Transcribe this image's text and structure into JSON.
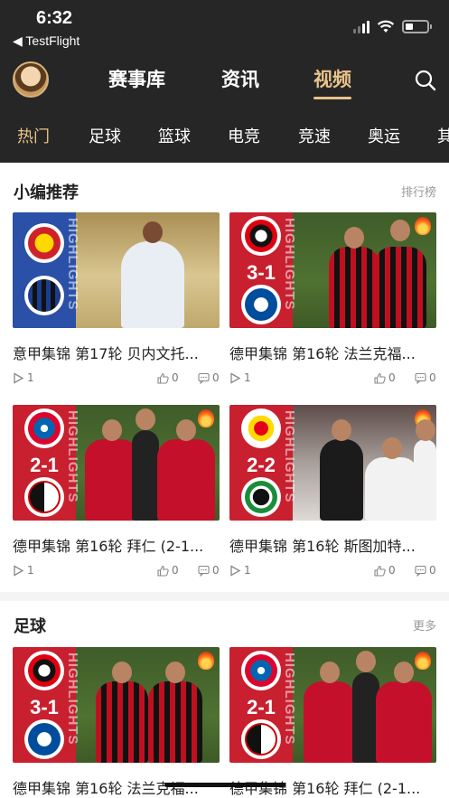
{
  "status": {
    "time": "6:32",
    "back_app": "◀ TestFlight"
  },
  "nav": {
    "tabs": [
      "赛事库",
      "资讯",
      "视频"
    ],
    "active_tab": "视频"
  },
  "categories": [
    "热门",
    "足球",
    "篮球",
    "电竞",
    "竞速",
    "奥运",
    "其"
  ],
  "active_category": "热门",
  "sections": [
    {
      "title": "小编推荐",
      "more": "排行榜",
      "cards": [
        {
          "title": "意甲集锦 第17轮 贝内文托...",
          "plays": "1",
          "likes": "0",
          "comments": "0",
          "score": "",
          "overlay": "HIGHLIGHTS"
        },
        {
          "title": "德甲集锦 第16轮 法兰克福...",
          "plays": "1",
          "likes": "0",
          "comments": "0",
          "score": "3-1",
          "overlay": "HIGHLIGHTS"
        },
        {
          "title": "德甲集锦 第16轮 拜仁 (2-1...",
          "plays": "1",
          "likes": "0",
          "comments": "0",
          "score": "2-1",
          "overlay": "HIGHLIGHTS"
        },
        {
          "title": "德甲集锦 第16轮 斯图加特...",
          "plays": "1",
          "likes": "0",
          "comments": "0",
          "score": "2-2",
          "overlay": "HIGHLIGHTS"
        }
      ]
    },
    {
      "title": "足球",
      "more": "更多",
      "cards": [
        {
          "title": "德甲集锦 第16轮 法兰克福...",
          "score": "3-1",
          "overlay": "HIGHLIGHTS"
        },
        {
          "title": "德甲集锦 第16轮 拜仁 (2-1...",
          "score": "2-1",
          "overlay": "HIGHLIGHTS"
        }
      ]
    }
  ],
  "colors": {
    "header_bg": "#262626",
    "accent": "#e9c38a",
    "highlight_red": "#c8202f",
    "highlight_blue": "#2a50a8"
  },
  "icons": [
    "search-icon",
    "play-icon",
    "like-icon",
    "comment-icon",
    "fire-icon"
  ]
}
